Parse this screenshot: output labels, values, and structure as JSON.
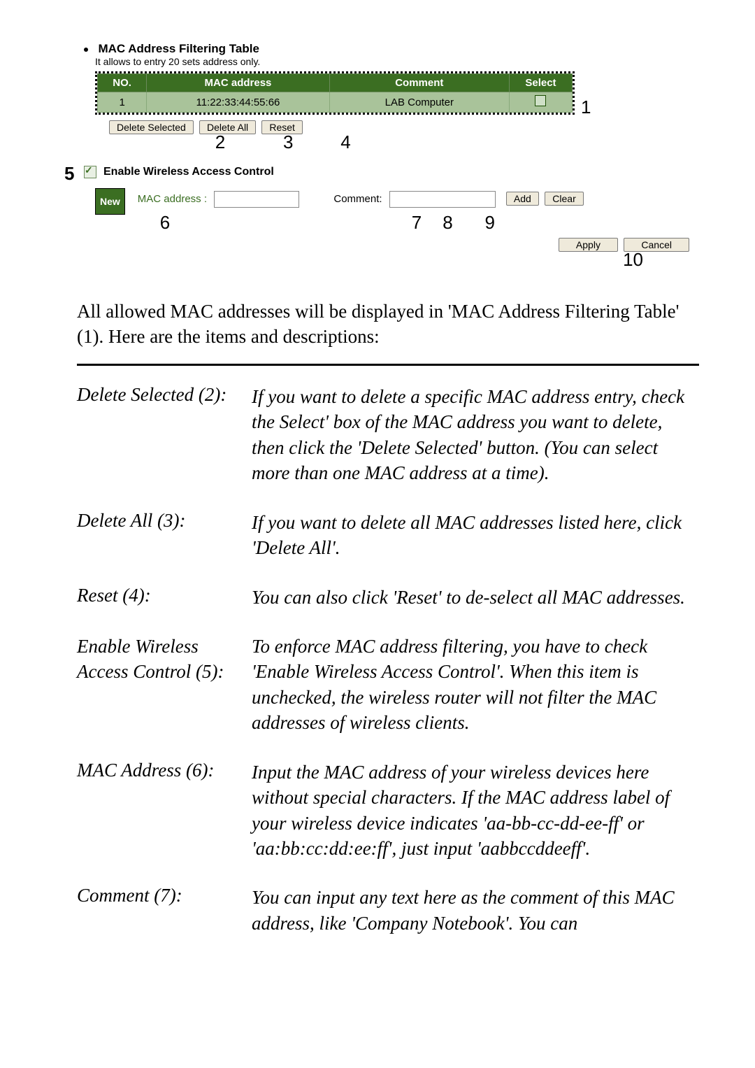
{
  "figure": {
    "title": "MAC Address Filtering Table",
    "subtitle": "It allows to entry 20 sets address only.",
    "table": {
      "headers": {
        "no": "NO.",
        "mac": "MAC address",
        "comment": "Comment",
        "select": "Select"
      },
      "row": {
        "no": "1",
        "mac": "11:22:33:44:55:66",
        "comment": "LAB Computer"
      }
    },
    "buttons": {
      "delete_selected": "Delete Selected",
      "delete_all": "Delete All",
      "reset": "Reset",
      "add": "Add",
      "clear": "Clear",
      "apply": "Apply",
      "cancel": "Cancel"
    },
    "enable_label": "Enable Wireless Access Control",
    "new_tag": "New",
    "mac_field_label": "MAC address :",
    "comment_field_label": "Comment:",
    "callouts": {
      "n1": "1",
      "n2": "2",
      "n3": "3",
      "n4": "4",
      "n5": "5",
      "n6": "6",
      "n7": "7",
      "n8": "8",
      "n9": "9",
      "n10": "10"
    }
  },
  "intro_text": "All allowed MAC addresses will be displayed in 'MAC Address Filtering Table' (1). Here are the items and descriptions:",
  "defs": {
    "d2": {
      "term": "Delete Selected (2):",
      "desc": "If you want to delete a specific MAC address entry, check the Select' box of the MAC address you want to delete, then click the 'Delete Selected' button. (You can select more than one MAC address at a time)."
    },
    "d3": {
      "term": "Delete All (3):",
      "desc": "If you want to delete all MAC addresses listed here, click 'Delete All'."
    },
    "d4": {
      "term": "Reset (4):",
      "desc": "You can also click 'Reset' to de-select all MAC addresses."
    },
    "d5": {
      "term_a": "Enable Wireless",
      "term_b": "Access Control (5):",
      "desc": "To enforce MAC address filtering, you have to check 'Enable Wireless Access Control'. When this item is unchecked, the wireless router will not filter the MAC addresses of wireless clients."
    },
    "d6": {
      "term": "MAC Address (6):",
      "desc": "Input the MAC address of your wireless devices here without special characters. If the MAC address label of your wireless device indicates 'aa-bb-cc-dd-ee-ff' or 'aa:bb:cc:dd:ee:ff', just input 'aabbccddeeff'."
    },
    "d7": {
      "term": "Comment (7):",
      "desc": "You can input any text here as the comment of this MAC address, like 'Company Notebook'. You can"
    }
  }
}
